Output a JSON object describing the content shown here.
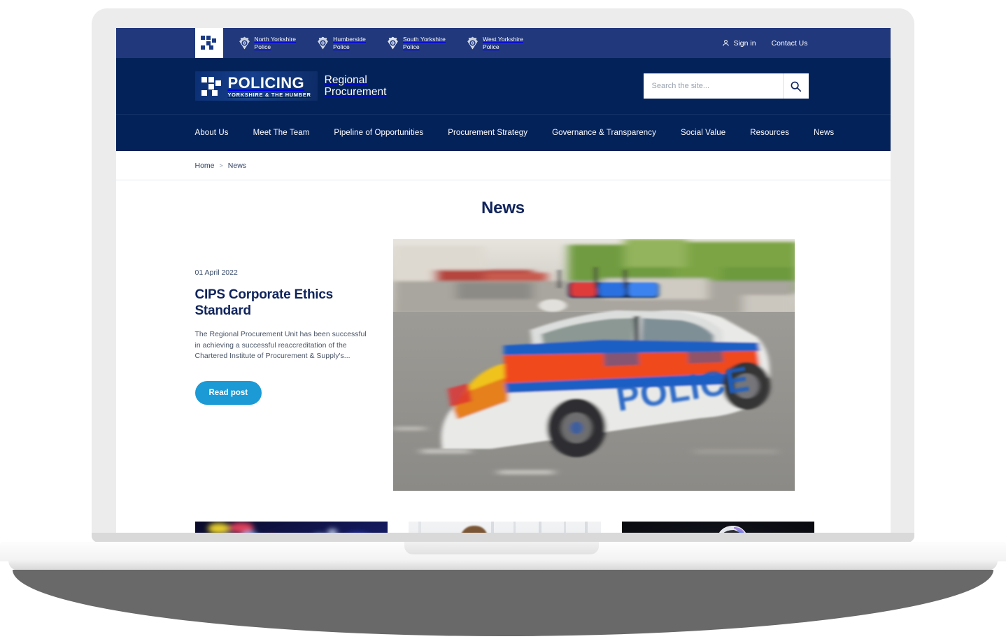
{
  "topbar": {
    "logo_alt": "policing-pixel-logo",
    "forces": [
      {
        "name": "North Yorkshire\nPolice",
        "icon": "police-crest-icon"
      },
      {
        "name": "Humberside\nPolice",
        "icon": "police-crest-icon"
      },
      {
        "name": "South Yorkshire\nPolice",
        "icon": "police-crest-icon"
      },
      {
        "name": "West Yorkshire\nPolice",
        "icon": "police-crest-icon"
      }
    ],
    "sign_in": "Sign in",
    "contact": "Contact Us"
  },
  "header": {
    "brand_word": "POLICING",
    "brand_sub": "YORKSHIRE & THE HUMBER",
    "tagline": "Regional\nProcurement",
    "search_placeholder": "Search the site...",
    "search_value": "",
    "search_icon": "search-icon"
  },
  "nav": {
    "items": [
      {
        "label": "About Us"
      },
      {
        "label": "Meet The Team"
      },
      {
        "label": "Pipeline of Opportunities"
      },
      {
        "label": "Procurement Strategy"
      },
      {
        "label": "Governance & Transparency"
      },
      {
        "label": "Social Value"
      },
      {
        "label": "Resources"
      },
      {
        "label": "News"
      }
    ]
  },
  "breadcrumb": {
    "home": "Home",
    "separator": ">",
    "current": "News"
  },
  "page": {
    "title": "News"
  },
  "feature": {
    "date": "01 April 2022",
    "title": "CIPS Corporate Ethics Standard",
    "excerpt": "The Regional Procurement Unit has been successful in achieving a successful reaccreditation of the Chartered Institute of Procurement & Supply's...",
    "button_label": "Read post",
    "image_alt": "police-car-in-motion-photo"
  },
  "cards": [
    {
      "image_alt": "police-vehicle-night-lights-photo"
    },
    {
      "image_alt": "two-business-professionals-photo"
    },
    {
      "image_alt": "police-motorcyclist-hi-vis-photo"
    }
  ],
  "colors": {
    "topbar_navy": "#21387c",
    "header_navy": "#03225a",
    "accent_blue": "#1b9ad6",
    "heading_navy": "#10245c",
    "laptop_bezel": "#ececec"
  }
}
